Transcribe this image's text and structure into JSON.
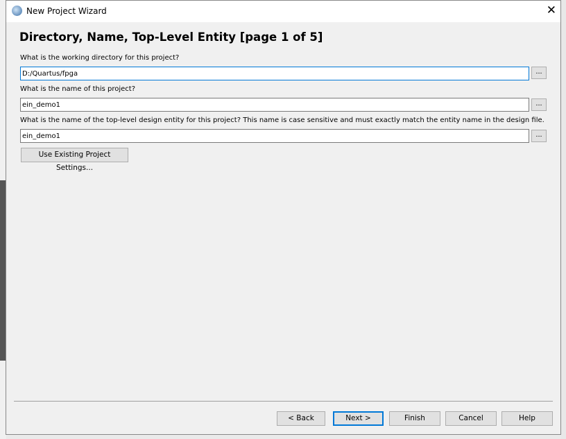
{
  "window": {
    "title": "New Project Wizard",
    "close_glyph": "✕"
  },
  "heading": "Directory, Name, Top-Level Entity [page 1 of 5]",
  "fields": [
    {
      "label": "What is the working directory for this project?",
      "value": "D:/Quartus/fpga"
    },
    {
      "label": "What is the name of this project?",
      "value": "ein_demo1"
    },
    {
      "label": "What is the name of the top-level design entity for this project? This name is case sensitive and must exactly match the entity name in the design file.",
      "value": "ein_demo1"
    }
  ],
  "browse_label": "...",
  "use_existing_label": "Use Existing Project Settings...",
  "buttons": {
    "back": "< Back",
    "next": "Next >",
    "finish": "Finish",
    "cancel": "Cancel",
    "help": "Help"
  }
}
